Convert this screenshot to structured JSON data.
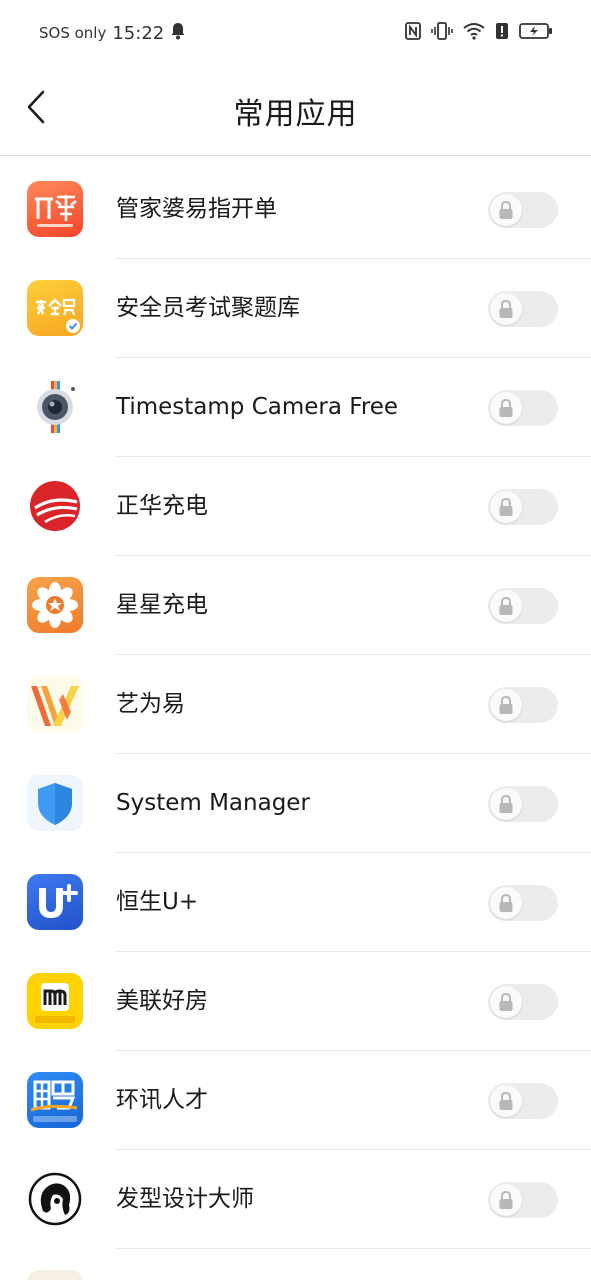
{
  "status_bar": {
    "carrier": "SOS only",
    "time": "15:22",
    "icons": [
      "bell-icon",
      "nfc-icon",
      "vibrate-icon",
      "wifi-icon",
      "alert-icon",
      "battery-charging-icon"
    ]
  },
  "header": {
    "back_icon": "chevron-left-icon",
    "title": "常用应用"
  },
  "apps": [
    {
      "name": "管家婆易指开单",
      "icon": "guanjiapo-icon",
      "locked": false
    },
    {
      "name": "安全员考试聚题库",
      "icon": "anquanyuan-icon",
      "locked": false
    },
    {
      "name": "Timestamp Camera Free",
      "icon": "timestamp-camera-icon",
      "locked": false
    },
    {
      "name": "正华充电",
      "icon": "zhenghua-icon",
      "locked": false
    },
    {
      "name": "星星充电",
      "icon": "xingxing-icon",
      "locked": false
    },
    {
      "name": "艺为易",
      "icon": "yiweiyi-icon",
      "locked": false
    },
    {
      "name": "System Manager",
      "icon": "system-manager-shield-icon",
      "locked": false
    },
    {
      "name": "恒生U+",
      "icon": "hengsheng-icon",
      "locked": false
    },
    {
      "name": "美联好房",
      "icon": "meilian-icon",
      "locked": false
    },
    {
      "name": "环讯人才",
      "icon": "huanxun-icon",
      "locked": false
    },
    {
      "name": "发型设计大师",
      "icon": "hairstyle-icon",
      "locked": false
    }
  ],
  "colors": {
    "toggle_track": "#ececec",
    "lock_icon": "#b8b8b8",
    "divider": "#e8e8e8"
  }
}
